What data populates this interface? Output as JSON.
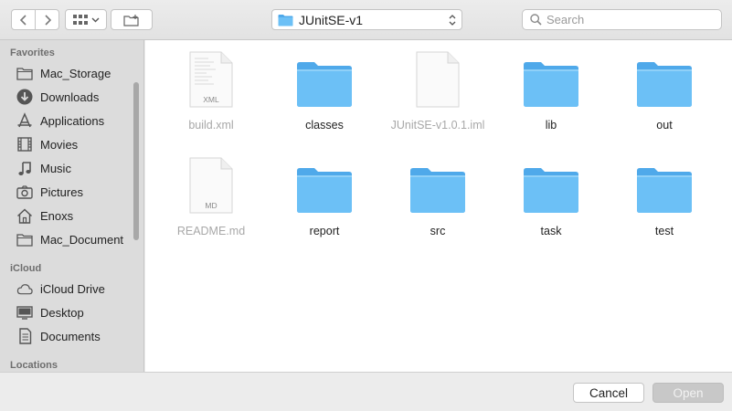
{
  "toolbar": {
    "path_label": "JUnitSE-v1",
    "search_placeholder": "Search"
  },
  "sidebar": {
    "sections": [
      {
        "label": "Favorites",
        "items": [
          {
            "label": "Mac_Storage",
            "icon": "folder-icon"
          },
          {
            "label": "Downloads",
            "icon": "download-icon"
          },
          {
            "label": "Applications",
            "icon": "applications-icon"
          },
          {
            "label": "Movies",
            "icon": "film-icon"
          },
          {
            "label": "Music",
            "icon": "music-note-icon"
          },
          {
            "label": "Pictures",
            "icon": "camera-icon"
          },
          {
            "label": "Enoxs",
            "icon": "home-icon"
          },
          {
            "label": "Mac_Document",
            "icon": "folder-icon"
          }
        ]
      },
      {
        "label": "iCloud",
        "items": [
          {
            "label": "iCloud Drive",
            "icon": "cloud-icon"
          },
          {
            "label": "Desktop",
            "icon": "desktop-icon"
          },
          {
            "label": "Documents",
            "icon": "document-icon"
          }
        ]
      },
      {
        "label": "Locations",
        "items": []
      }
    ]
  },
  "files": [
    {
      "name": "build.xml",
      "kind": "document",
      "badge": "XML",
      "dimmed": true
    },
    {
      "name": "classes",
      "kind": "folder",
      "dimmed": false
    },
    {
      "name": "JUnitSE-v1.0.1.iml",
      "kind": "document",
      "badge": "",
      "dimmed": true
    },
    {
      "name": "lib",
      "kind": "folder",
      "dimmed": false
    },
    {
      "name": "out",
      "kind": "folder",
      "dimmed": false
    },
    {
      "name": "README.md",
      "kind": "document",
      "badge": "MD",
      "dimmed": true
    },
    {
      "name": "report",
      "kind": "folder",
      "dimmed": false
    },
    {
      "name": "src",
      "kind": "folder",
      "dimmed": false
    },
    {
      "name": "task",
      "kind": "folder",
      "dimmed": false
    },
    {
      "name": "test",
      "kind": "folder",
      "dimmed": false
    }
  ],
  "buttons": {
    "cancel": "Cancel",
    "open": "Open"
  },
  "colors": {
    "folder": "#5ab8f5",
    "folder_tab": "#7ccaf7",
    "sidebar_bg": "#dcdcdc",
    "open_disabled": "#c8c8c8"
  }
}
